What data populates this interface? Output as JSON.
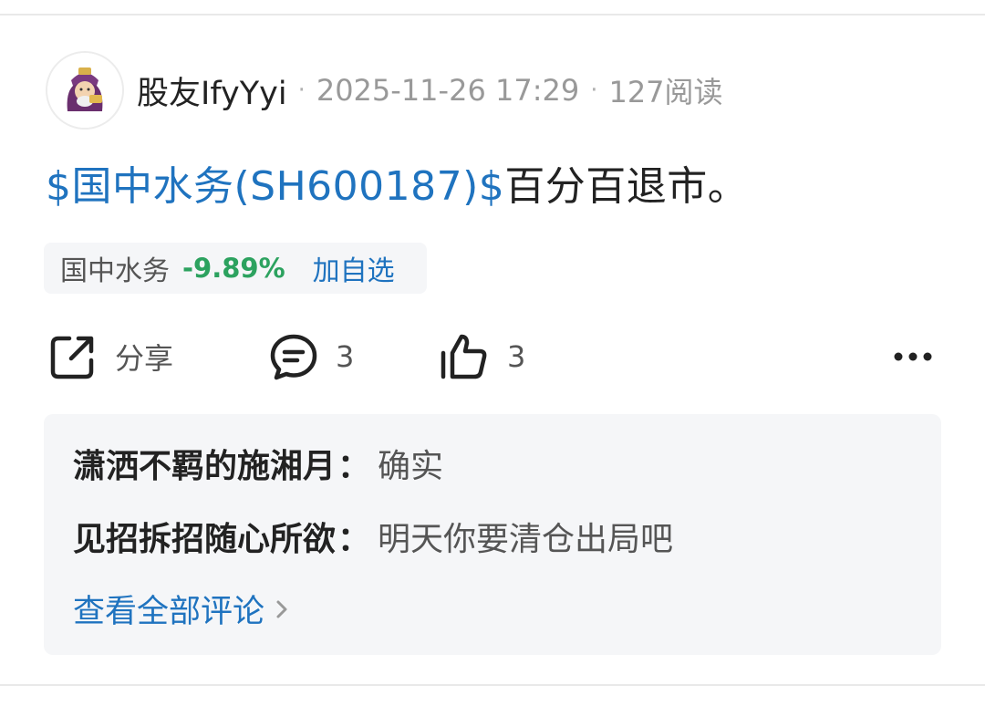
{
  "post": {
    "author": "股友IfyYyi",
    "separator": "·",
    "datetime": "2025-11-26 17:29",
    "reads": "127阅读",
    "stock_tag": "$国中水务(SH600187)$",
    "body": "百分百退市。"
  },
  "stock_chip": {
    "name": "国中水务",
    "change": "-9.89%",
    "add_label": "加自选",
    "change_color": "#2ca25f"
  },
  "actions": {
    "share_label": "分享",
    "comment_count": "3",
    "like_count": "3",
    "icons": [
      "share-icon",
      "comment-icon",
      "thumbs-up-icon",
      "more-icon"
    ]
  },
  "comments": {
    "items": [
      {
        "user": "潇洒不羁的施湘月",
        "colon": "：",
        "text": "确实"
      },
      {
        "user": "见招拆招随心所欲",
        "colon": "：",
        "text": "明天你要清仓出局吧"
      }
    ],
    "view_all_label": "查看全部评论",
    "link_color": "#1f73bf"
  }
}
